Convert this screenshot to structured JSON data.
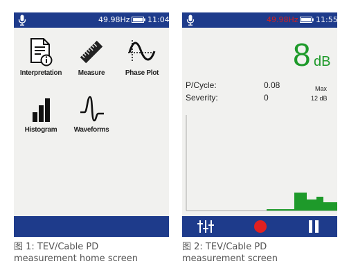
{
  "screen1": {
    "status": {
      "frequency": "49.98Hz",
      "time": "11:04",
      "frequency_color": "#ffffff"
    },
    "menu": [
      {
        "label": "Interpretation",
        "icon": "document-info-icon"
      },
      {
        "label": "Measure",
        "icon": "ruler-icon"
      },
      {
        "label": "Phase Plot",
        "icon": "phase-wave-icon"
      },
      {
        "label": "Histogram",
        "icon": "bar-chart-icon"
      },
      {
        "label": "Waveforms",
        "icon": "waveform-icon"
      }
    ],
    "caption": {
      "line1": "图 1: TEV/Cable PD",
      "line2": "measurement home screen"
    }
  },
  "screen2": {
    "status": {
      "frequency": "49.98Hz",
      "time": "11:55",
      "frequency_color": "#d22020"
    },
    "reading": {
      "value": "8",
      "unit": "dB",
      "color": "#1e9a2a"
    },
    "metrics": [
      {
        "label": "P/Cycle:",
        "value": "0.08"
      },
      {
        "label": "Severity:",
        "value": "0"
      }
    ],
    "max": {
      "label": "Max",
      "value": "12 dB"
    },
    "controls": [
      {
        "name": "settings-sliders-icon"
      },
      {
        "name": "record-icon",
        "color": "#e02020"
      },
      {
        "name": "pause-icon"
      }
    ],
    "caption": {
      "line1": "图 2: TEV/Cable PD",
      "line2": "measurement screen"
    }
  },
  "colors": {
    "bar": "#1e3b8b",
    "background": "#f1f1ef",
    "accent_green": "#1e9a2a"
  }
}
